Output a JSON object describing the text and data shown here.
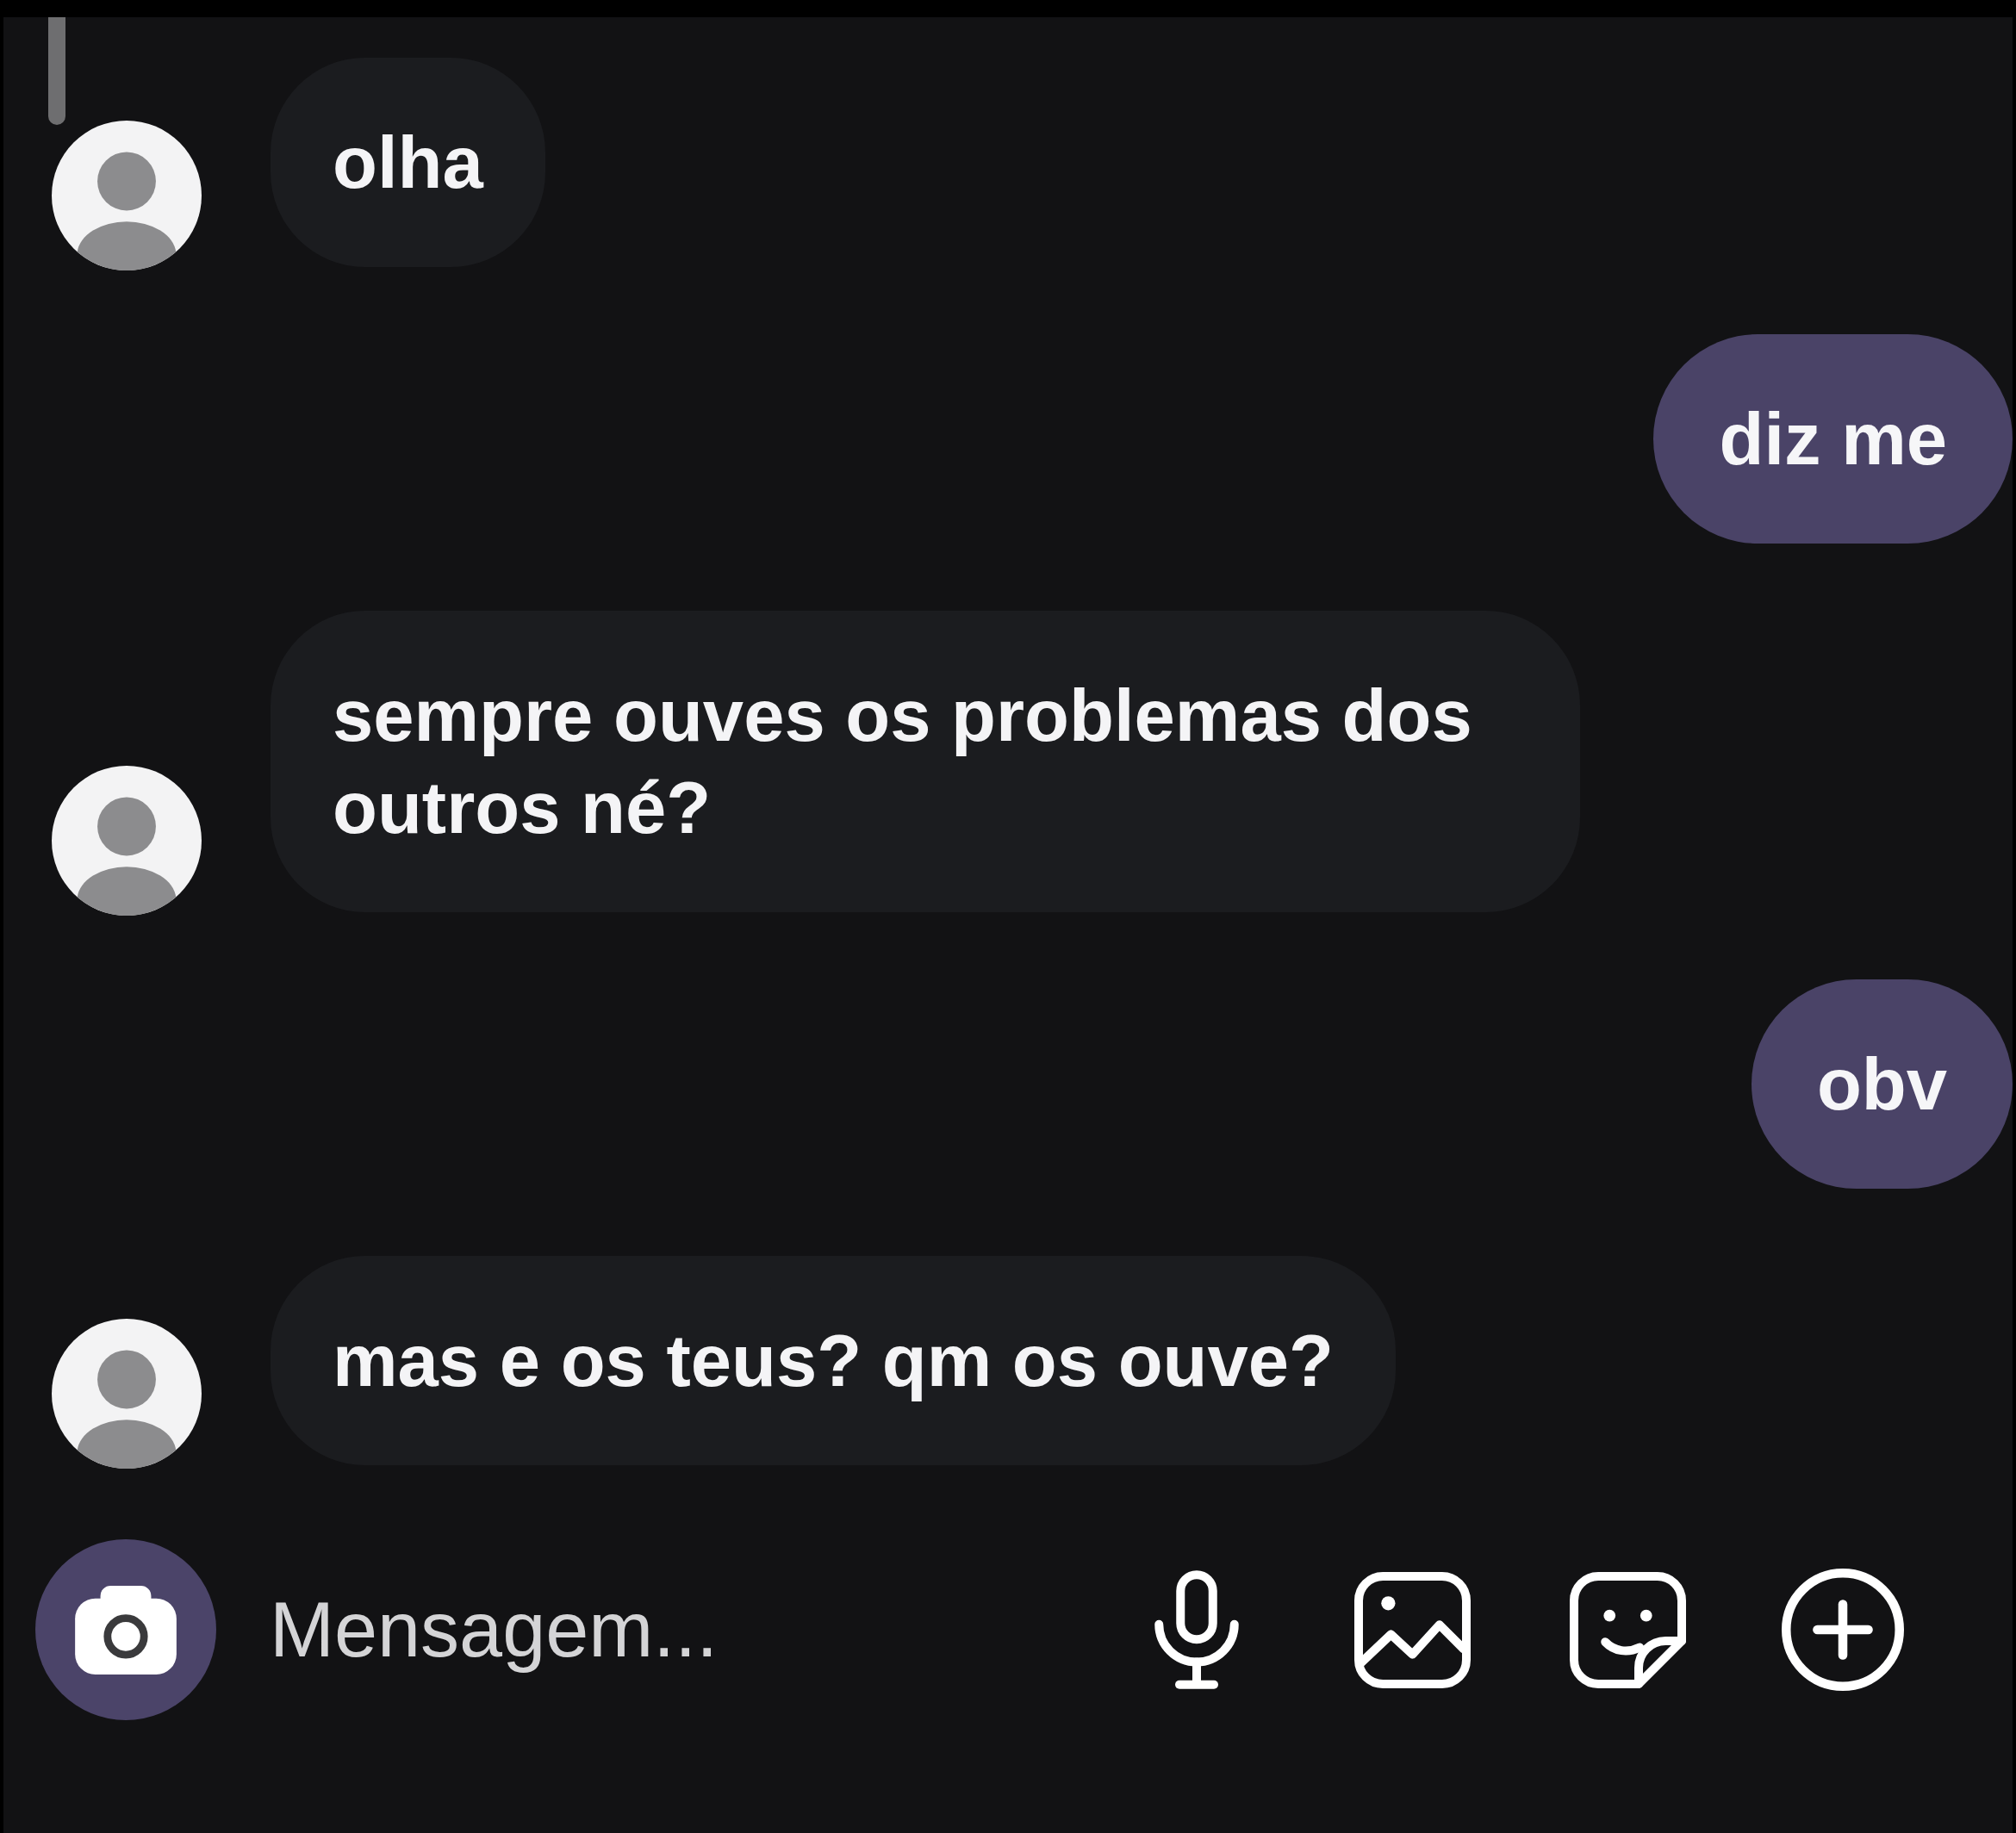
{
  "messages": [
    {
      "kind": "received",
      "text": "olha"
    },
    {
      "kind": "sent",
      "text": "diz me"
    },
    {
      "kind": "received",
      "text": "sempre ouves os problemas dos outros né?"
    },
    {
      "kind": "sent",
      "text": "obv"
    },
    {
      "kind": "received",
      "text": "mas e os teus? qm os ouve?"
    }
  ],
  "composer": {
    "placeholder": "Mensagem..."
  }
}
